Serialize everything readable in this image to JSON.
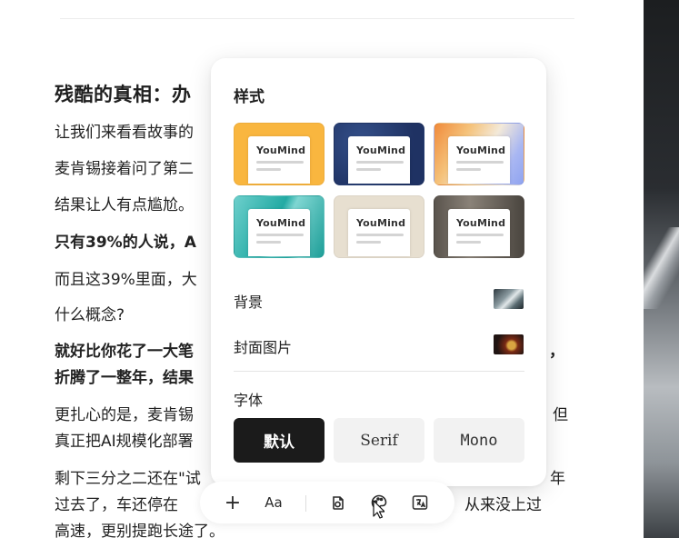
{
  "article": {
    "heading": "残酷的真相：办",
    "lines": [
      {
        "text": "让我们来看看故事的",
        "bold": false
      },
      {
        "text": "麦肯锡接着问了第二",
        "bold": false
      },
      {
        "text": "结果让人有点尴尬。",
        "bold": false
      },
      {
        "text": "只有39%的人说，A",
        "bold": true
      },
      {
        "text": "而且这39%里面，大",
        "bold": false
      },
      {
        "text": "什么概念?",
        "bold": false
      },
      {
        "text": "就好比你花了一大笔",
        "bold": true
      },
      {
        "text": "折腾了一整年，结果",
        "bold": true
      },
      {
        "text": "更扎心的是，麦肯锡",
        "bold": false
      },
      {
        "text": "真正把AI规模化部署",
        "bold": false
      },
      {
        "text": "剩下三分之二还在\"试",
        "bold": false
      },
      {
        "text": "过去了，车还停在",
        "bold": false
      },
      {
        "text": "高速，更别提跑长途了。",
        "bold": false
      }
    ],
    "right_fragments": [
      "，",
      "但",
      "年",
      "从来没上过"
    ]
  },
  "style_panel": {
    "title": "样式",
    "themes": [
      {
        "name": "YouMind",
        "style": "yellow"
      },
      {
        "name": "YouMind",
        "style": "navy"
      },
      {
        "name": "YouMind",
        "style": "gradient"
      },
      {
        "name": "YouMind",
        "style": "teal"
      },
      {
        "name": "YouMind",
        "style": "paper"
      },
      {
        "name": "YouMind",
        "style": "charcoal"
      }
    ],
    "background_label": "背景",
    "cover_label": "封面图片",
    "font_label": "字体",
    "fonts": [
      {
        "label": "默认",
        "active": true
      },
      {
        "label": "Serif",
        "active": false
      },
      {
        "label": "Mono",
        "active": false
      }
    ]
  },
  "toolbar": {
    "plus_icon": "+",
    "text_size_label": "Aa",
    "icons": [
      "plus-icon",
      "text-size-icon",
      "audio-icon",
      "palette-icon",
      "translate-icon"
    ]
  },
  "colors": {
    "accent_dark": "#1b1b1b",
    "theme_yellow": "#f9b63f",
    "theme_navy": "#263c6e",
    "theme_teal": "#22aaa3"
  }
}
